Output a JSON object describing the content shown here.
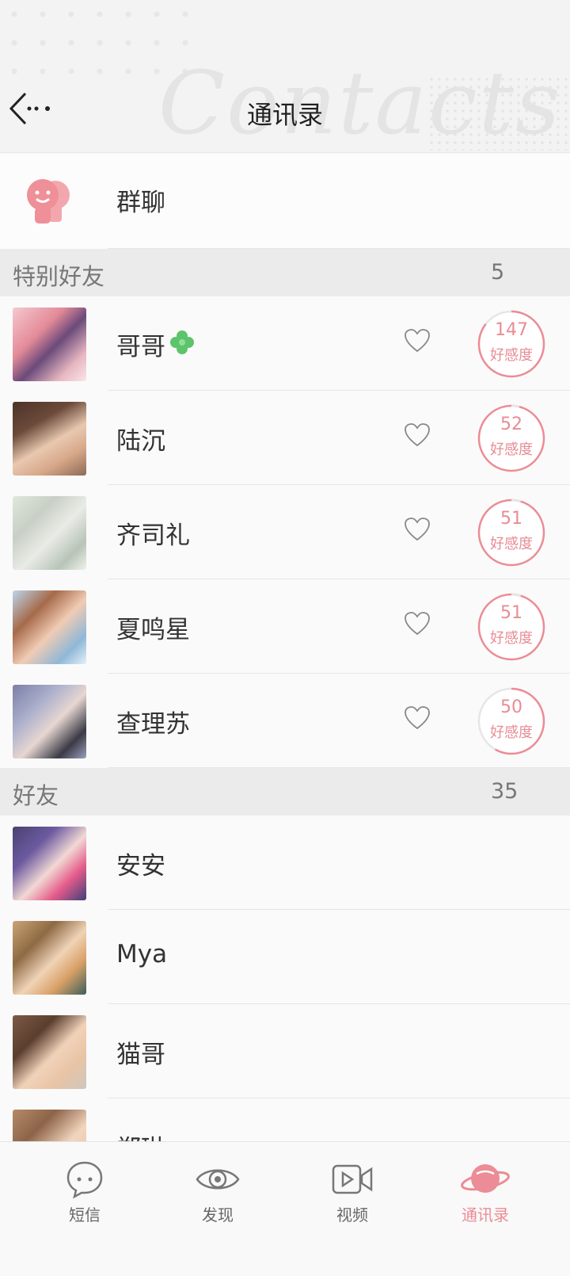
{
  "header": {
    "title": "通讯录",
    "watermark": "Contacts"
  },
  "group_chat": {
    "label": "群聊"
  },
  "special": {
    "title": "特别好友",
    "count": "5",
    "items": [
      {
        "name": "哥哥",
        "favor": "147",
        "favor_label": "好感度",
        "has_clover": true
      },
      {
        "name": "陆沉",
        "favor": "52",
        "favor_label": "好感度"
      },
      {
        "name": "齐司礼",
        "favor": "51",
        "favor_label": "好感度"
      },
      {
        "name": "夏鸣星",
        "favor": "51",
        "favor_label": "好感度"
      },
      {
        "name": "查理苏",
        "favor": "50",
        "favor_label": "好感度"
      }
    ]
  },
  "friends": {
    "title": "好友",
    "count": "35",
    "items": [
      {
        "name": "安安"
      },
      {
        "name": "Mya"
      },
      {
        "name": "猫哥"
      },
      {
        "name": "郑琳"
      }
    ]
  },
  "tabs": [
    {
      "label": "短信",
      "icon": "chat-bubble-icon"
    },
    {
      "label": "发现",
      "icon": "eye-icon"
    },
    {
      "label": "视频",
      "icon": "video-icon"
    },
    {
      "label": "通讯录",
      "icon": "planet-icon",
      "active": true
    }
  ],
  "colors": {
    "accent": "#ec8c96",
    "section_bg": "#ebebeb"
  }
}
